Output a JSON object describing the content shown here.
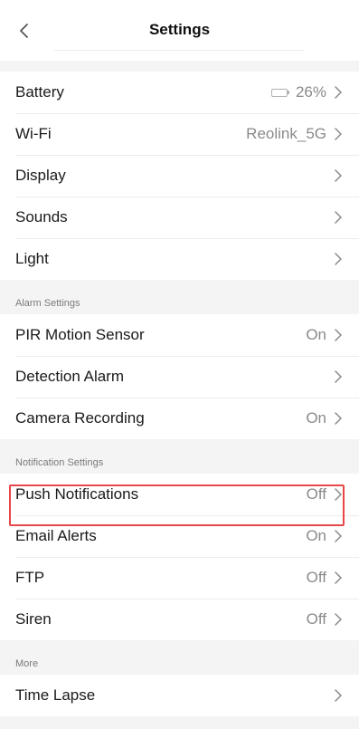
{
  "header": {
    "title": "Settings"
  },
  "general": [
    {
      "label": "Battery",
      "value": "26%",
      "battery_level": 0.26
    },
    {
      "label": "Wi-Fi",
      "value": "Reolink_5G"
    },
    {
      "label": "Display",
      "value": ""
    },
    {
      "label": "Sounds",
      "value": ""
    },
    {
      "label": "Light",
      "value": ""
    }
  ],
  "alarm": {
    "title": "Alarm Settings",
    "items": [
      {
        "label": "PIR Motion Sensor",
        "value": "On"
      },
      {
        "label": "Detection Alarm",
        "value": ""
      },
      {
        "label": "Camera Recording",
        "value": "On"
      }
    ]
  },
  "notification": {
    "title": "Notification Settings",
    "items": [
      {
        "label": "Push Notifications",
        "value": "Off"
      },
      {
        "label": "Email Alerts",
        "value": "On"
      },
      {
        "label": "FTP",
        "value": "Off"
      },
      {
        "label": "Siren",
        "value": "Off"
      }
    ]
  },
  "more": {
    "title": "More",
    "items": [
      {
        "label": "Time Lapse",
        "value": ""
      }
    ]
  },
  "colors": {
    "highlight": "#e8474a",
    "battery_fill": "#f28a1f"
  }
}
